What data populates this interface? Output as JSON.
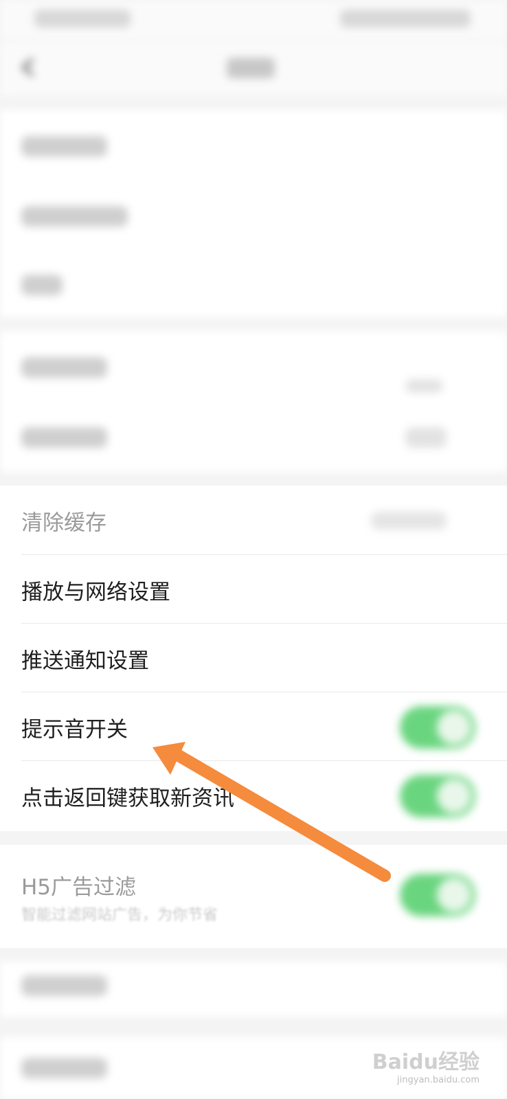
{
  "settings": {
    "items": [
      {
        "label": "清除缓存",
        "faded": true
      },
      {
        "label": "播放与网络设置"
      },
      {
        "label": "推送通知设置"
      },
      {
        "label": "提示音开关",
        "toggle": true,
        "on": true
      },
      {
        "label": "点击返回键获取新资讯",
        "toggle": true,
        "on": true
      }
    ],
    "h5": {
      "label": "H5广告过滤",
      "sublabel": "智能过滤网站广告，为你节省",
      "on": true
    }
  },
  "colors": {
    "toggle_on": "#6ad57f",
    "arrow": "#f58b3c",
    "page_bg": "#f4f4f4"
  },
  "watermark": {
    "brand": "Baidu经验",
    "site": "jingyan.baidu.com"
  }
}
